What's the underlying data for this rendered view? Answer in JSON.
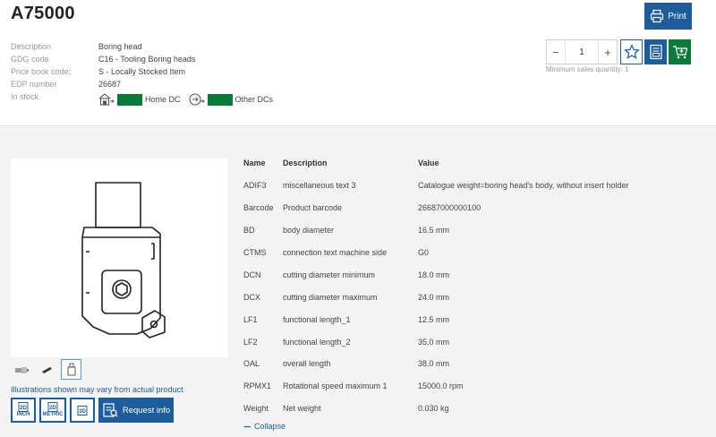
{
  "product": {
    "code": "A75000",
    "print_label": "Print",
    "info": [
      {
        "label": "Description",
        "value": "Boring head"
      },
      {
        "label": "GDG code",
        "value": "C16 - Tooling Boring heads"
      },
      {
        "label": "Price book code:",
        "value": "S - Locally Stocked Item"
      },
      {
        "label": "EDP number",
        "value": "26687"
      },
      {
        "label": "In stock",
        "value": ""
      }
    ],
    "stock": {
      "home_label": "Home DC",
      "other_label": "Other DCs",
      "color": "#0a7a3a"
    }
  },
  "cart": {
    "minus": "−",
    "plus": "+",
    "quantity": "1",
    "min_note": "Minimum sales quantity: 1"
  },
  "media": {
    "illustration_note": "Illustrations shown may vary from actual product",
    "downloads": [
      {
        "top": "2D",
        "bottom": "INCH"
      },
      {
        "top": "2D",
        "bottom": "METRIC"
      },
      {
        "top": "3D",
        "bottom": ""
      }
    ],
    "request_label": "Request info"
  },
  "table": {
    "headers": [
      "Name",
      "Description",
      "Value"
    ],
    "rows": [
      [
        "ADIF3",
        "miscellaneous text 3",
        "Catalogue weight=boring head's body, without insert holder"
      ],
      [
        "Barcode",
        "Product barcode",
        "26687000000100"
      ],
      [
        "BD",
        "body diameter",
        "16.5 mm"
      ],
      [
        "CTMS",
        "connection text machine side",
        "G0"
      ],
      [
        "DCN",
        "cutting diameter minimum",
        "18.0 mm"
      ],
      [
        "DCX",
        "cutting diameter maximum",
        "24.0 mm"
      ],
      [
        "LF1",
        "functional length_1",
        "12.5 mm"
      ],
      [
        "LF2",
        "functional length_2",
        "35.0 mm"
      ],
      [
        "OAL",
        "overall length",
        "38.0 mm"
      ],
      [
        "RPMX1",
        "Rotational speed maximum 1",
        "15000.0 rpm"
      ],
      [
        "Weight",
        "Net weight",
        "0.030 kg"
      ]
    ],
    "collapse_label": "Collapse"
  },
  "colors": {
    "brand_blue": "#1d5d9b",
    "stock_green": "#0a7a3a",
    "panel_gray": "#f4f4f4"
  }
}
